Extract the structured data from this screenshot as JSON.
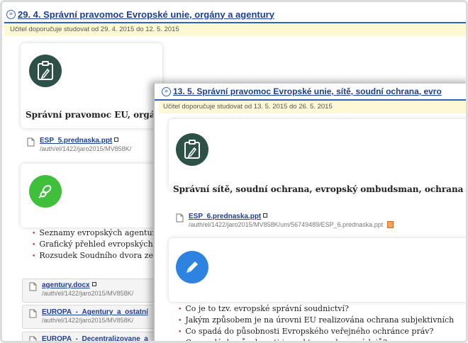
{
  "back": {
    "title": "29. 4. Správní pravomoc Evropské unie, orgány a agentury",
    "recommend": "Učitel doporučuje studovat od 29. 4. 2015 do 12. 5. 2015",
    "heading": "Správní pravomoc EU, orgá",
    "file1": {
      "name": "ESP_5.prednaska.ppt",
      "path": "/auth/el/1422/jaro2015/MV858K/"
    },
    "bullets": [
      "Seznamy evropských agentur",
      "Grafický přehled evropských",
      "Rozsudek Soudního dvora ze"
    ],
    "files": [
      {
        "name": "agentury.docx",
        "path": "/auth/el/1422/jaro2015/MV858K/"
      },
      {
        "name": "EUROPA_-_Agentury_a_ostatní",
        "path": "/auth/el/1422/jaro2015/MV858K/"
      },
      {
        "name": "EUROPA_-_Decentralizovane_a",
        "path": ""
      }
    ]
  },
  "front": {
    "title": "13. 5. Správní pravomoc Evropské unie, sítě, soudní ochrana, evro",
    "recommend": "Učitel doporučuje studovat od 13. 5. 2015 do 26. 5. 2015",
    "heading": "Správní sítě, soudní ochrana, evropský ombudsman, ochrana",
    "file1": {
      "name": "ESP_6.prednaska.ppt",
      "path": "/auth/el/1422/jaro2015/MV858K/um/56749489/ESP_6.prednaska.ppt"
    },
    "bullets": [
      "Co je to tzv. evropské správní soudnictví?",
      "Jakým způsobem je na úrovni EU realizována ochrana subjektivních",
      "Co spadá do působnosti Evropského veřejného ochránce práv?",
      "Co spadá do působnosti inspektora ochrany údajů?"
    ]
  },
  "colors": {
    "link": "#1c3f94",
    "rule": "#2f63b6",
    "recommend_bg": "#fff8d6",
    "clipboard_bg": "#2e5147",
    "green_icon": "#3fbf3c",
    "blue_icon": "#2f83e0"
  }
}
